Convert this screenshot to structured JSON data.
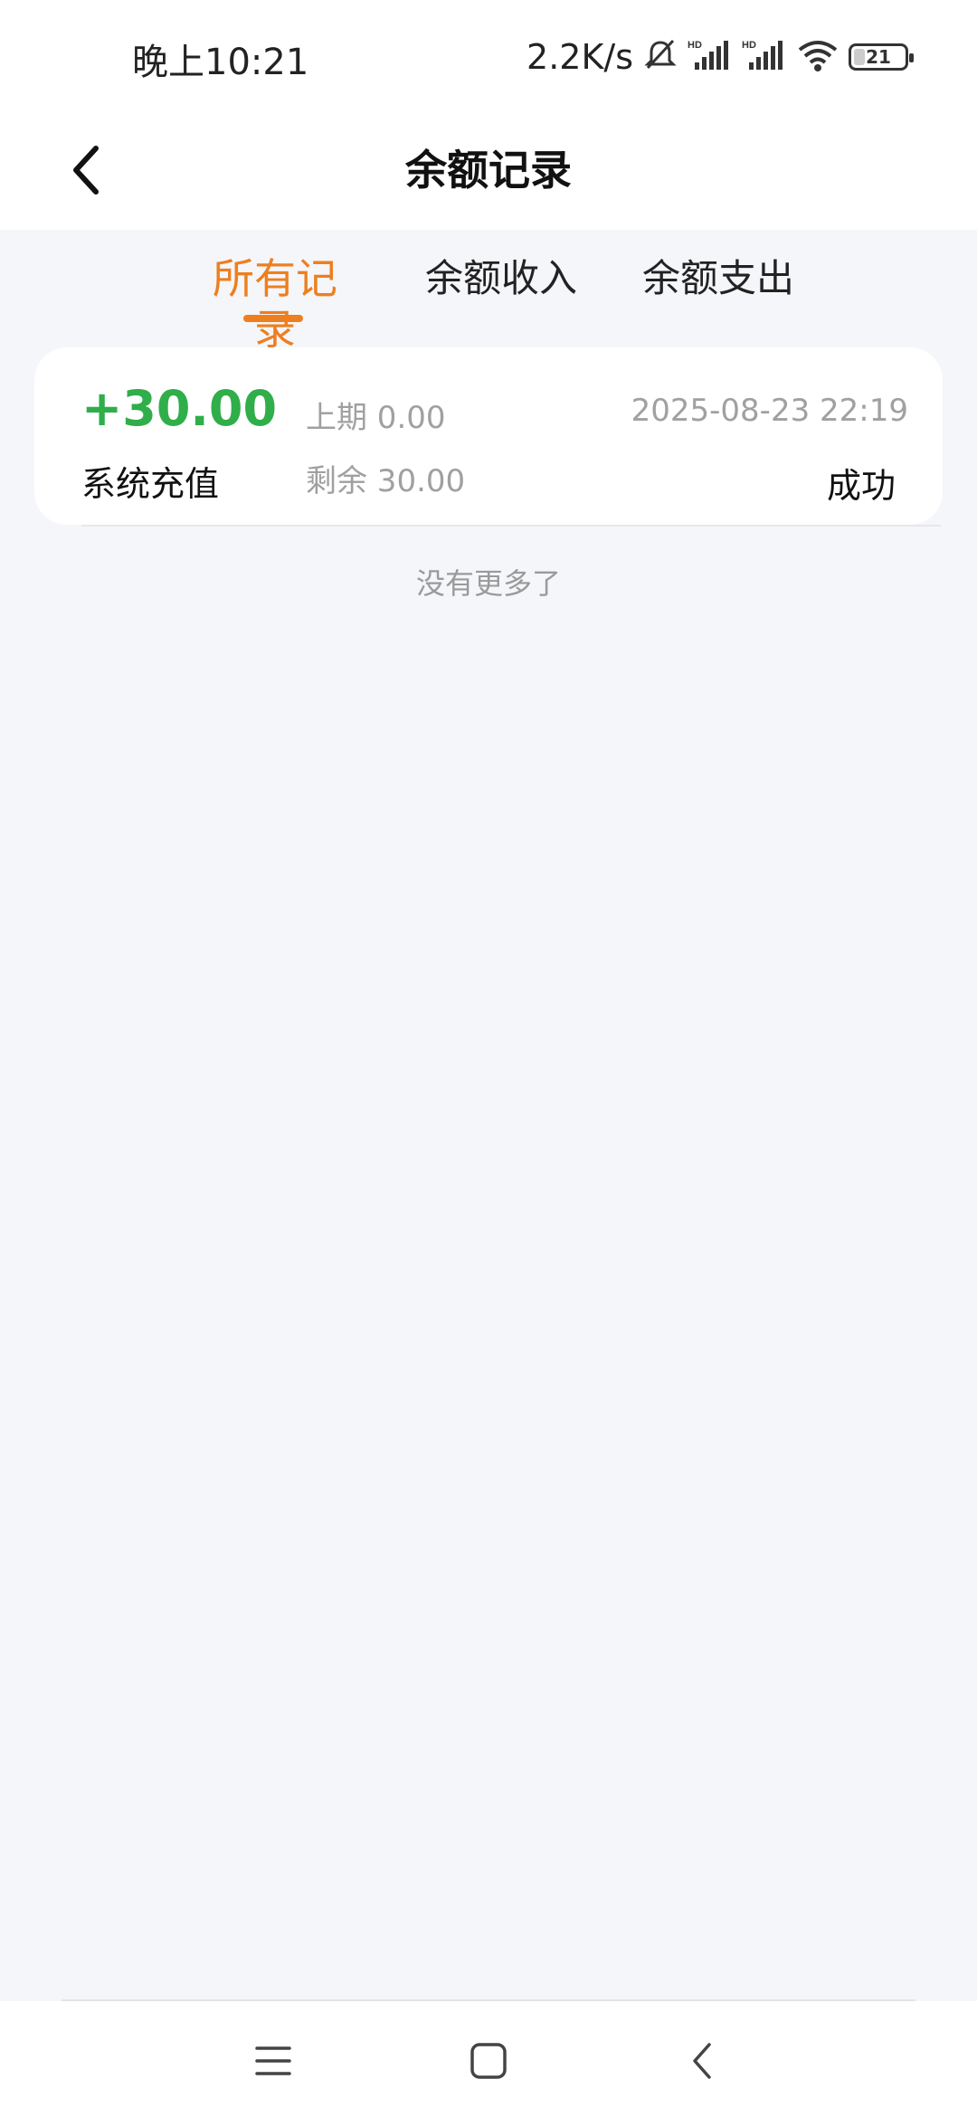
{
  "status_bar": {
    "time": "晚上10:21",
    "net_speed": "2.2K/s",
    "battery_level": "21",
    "icons": [
      "bell-muted-icon",
      "hd-signal-icon",
      "hd-signal-icon",
      "wifi-icon",
      "battery-icon"
    ]
  },
  "header": {
    "title": "余额记录",
    "back_icon": "chevron-left-icon"
  },
  "tabs": [
    {
      "label": "所有记录",
      "active": true
    },
    {
      "label": "余额收入",
      "active": false
    },
    {
      "label": "余额支出",
      "active": false
    }
  ],
  "records": [
    {
      "amount": "+30.00",
      "description": "系统充值",
      "previous": "上期 0.00",
      "remaining": "剩余 30.00",
      "datetime": "2025-08-23 22:19",
      "status": "成功"
    }
  ],
  "footer_text": "没有更多了",
  "colors": {
    "accent": "#ee7f1f",
    "income": "#2fae4a",
    "background": "#f5f6fa"
  },
  "system_nav": {
    "icons": [
      "menu-icon",
      "home-icon",
      "back-icon"
    ]
  }
}
